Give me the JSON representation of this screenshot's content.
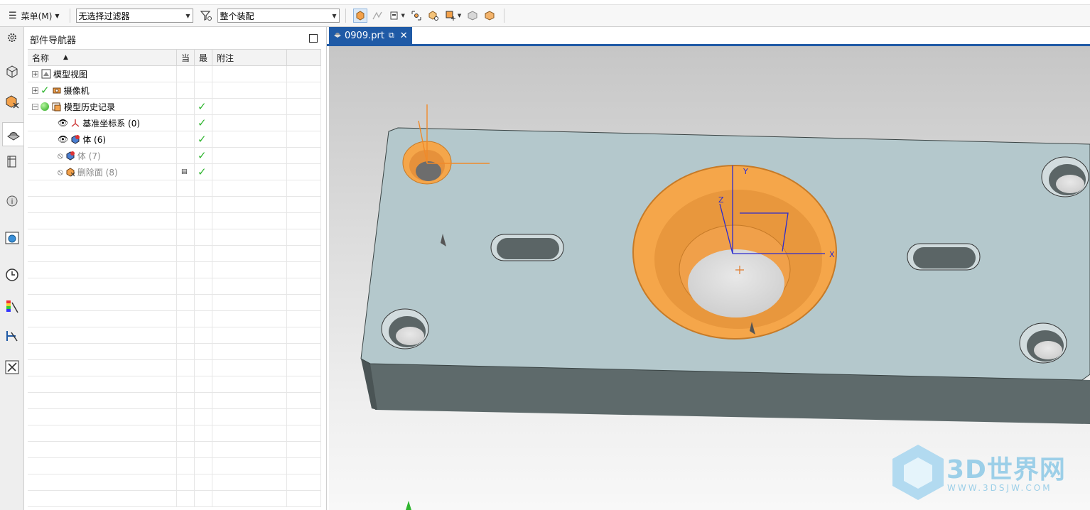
{
  "toolbar": {
    "menu_label": "菜单(M)",
    "filter_value": "无选择过滤器",
    "scope_value": "整个装配"
  },
  "navigator": {
    "title": "部件导航器",
    "columns": {
      "name": "名称",
      "current": "当",
      "latest": "最",
      "notes": "附注"
    },
    "rows": [
      {
        "label": "模型视图"
      },
      {
        "label": "摄像机"
      },
      {
        "label": "模型历史记录"
      },
      {
        "label": "基准坐标系 (0)"
      },
      {
        "label": "体 (6)"
      },
      {
        "label": "体 (7)"
      },
      {
        "label": "删除面 (8)"
      }
    ]
  },
  "tab": {
    "label": "0909.prt"
  },
  "axes": {
    "x": "X",
    "y": "Y",
    "z": "Z"
  },
  "watermark": {
    "main": "3D世界网",
    "url": "WWW.3DSJW.COM"
  },
  "colors": {
    "accent": "#1f5aa6",
    "feature": "#f5a64a",
    "plate_top": "#b3c7cb",
    "plate_side": "#5c6869",
    "check": "#2fb52f"
  }
}
